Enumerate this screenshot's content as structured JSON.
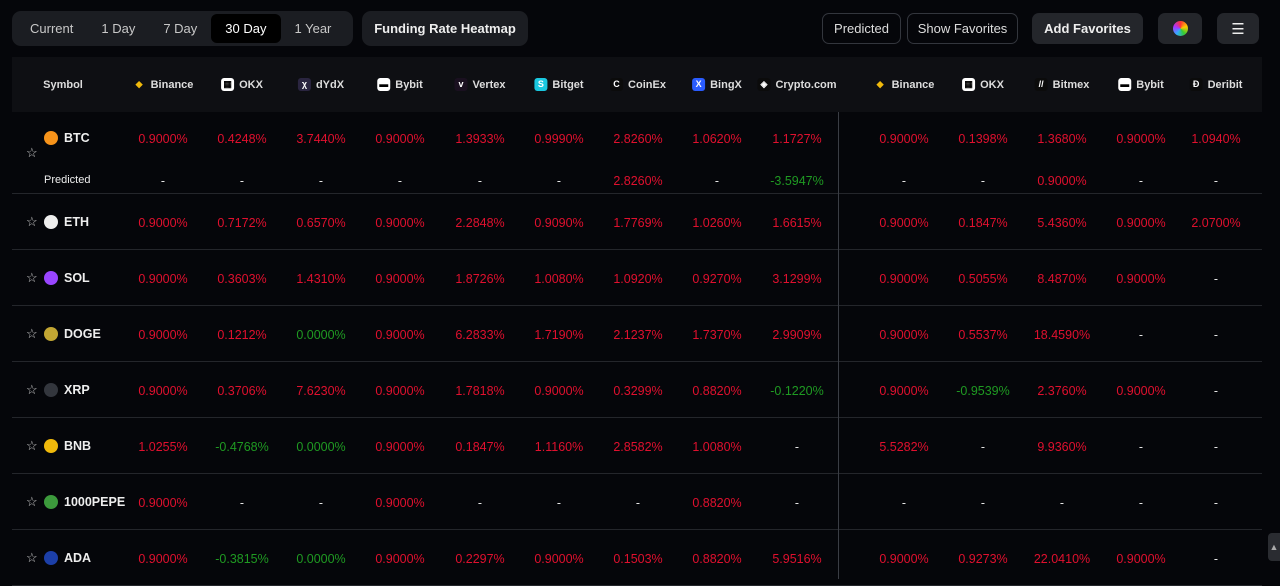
{
  "tabs": [
    "Current",
    "1 Day",
    "7 Day",
    "30 Day",
    "1 Year"
  ],
  "active_tab": "30 Day",
  "heatmap_label": "Funding Rate Heatmap",
  "buttons": {
    "predicted": "Predicted",
    "show_favorites": "Show Favorites",
    "add_favorites": "Add Favorites"
  },
  "colors": {
    "positive": "#e0102e",
    "negative": "#1f9a22"
  },
  "table": {
    "symbol_header": "Symbol",
    "predicted_label": "Predicted",
    "exchanges": [
      {
        "name": "Binance",
        "icon": "binance-icon",
        "color": "#f0b90b",
        "glyph": "◆"
      },
      {
        "name": "OKX",
        "icon": "okx-icon",
        "color": "#ffffff",
        "glyph": "▦"
      },
      {
        "name": "dYdX",
        "icon": "dydx-icon",
        "color": "#2a2540",
        "glyph": "χ"
      },
      {
        "name": "Bybit",
        "icon": "bybit-icon",
        "color": "#ffffff",
        "glyph": "▬"
      },
      {
        "name": "Vertex",
        "icon": "vertex-icon",
        "color": "#1a1020",
        "glyph": "v"
      },
      {
        "name": "Bitget",
        "icon": "bitget-icon",
        "color": "#1ac8e0",
        "glyph": "S"
      },
      {
        "name": "CoinEx",
        "icon": "coinex-icon",
        "color": "#0b0b0b",
        "glyph": "C"
      },
      {
        "name": "BingX",
        "icon": "bingx-icon",
        "color": "#2a5cff",
        "glyph": "X"
      },
      {
        "name": "Crypto.com",
        "icon": "cryptocom-icon",
        "color": "#0b0b0b",
        "glyph": "◈"
      },
      {
        "name": "Binance",
        "icon": "binance-icon",
        "color": "#f0b90b",
        "glyph": "◆"
      },
      {
        "name": "OKX",
        "icon": "okx-icon",
        "color": "#ffffff",
        "glyph": "▦"
      },
      {
        "name": "Bitmex",
        "icon": "bitmex-icon",
        "color": "#0b0b0b",
        "glyph": "//"
      },
      {
        "name": "Bybit",
        "icon": "bybit-icon",
        "color": "#ffffff",
        "glyph": "▬"
      },
      {
        "name": "Deribit",
        "icon": "deribit-icon",
        "color": "#0b0b0b",
        "glyph": "Ð"
      }
    ],
    "rows": [
      {
        "symbol": "BTC",
        "coin_color": "#f7931a",
        "values": [
          "0.9000%",
          "0.4248%",
          "3.7440%",
          "0.9000%",
          "1.3933%",
          "0.9990%",
          "2.8260%",
          "1.0620%",
          "1.1727%",
          "0.9000%",
          "0.1398%",
          "1.3680%",
          "0.9000%",
          "1.0940%"
        ],
        "predicted": [
          "-",
          "-",
          "-",
          "-",
          "-",
          "-",
          "2.8260%",
          "-",
          "-3.5947%",
          "-",
          "-",
          "0.9000%",
          "-",
          "-"
        ]
      },
      {
        "symbol": "ETH",
        "coin_color": "#eeeeee",
        "values": [
          "0.9000%",
          "0.7172%",
          "0.6570%",
          "0.9000%",
          "2.2848%",
          "0.9090%",
          "1.7769%",
          "1.0260%",
          "1.6615%",
          "0.9000%",
          "0.1847%",
          "5.4360%",
          "0.9000%",
          "2.0700%"
        ]
      },
      {
        "symbol": "SOL",
        "coin_color": "#9945ff",
        "values": [
          "0.9000%",
          "0.3603%",
          "1.4310%",
          "0.9000%",
          "1.8726%",
          "1.0080%",
          "1.0920%",
          "0.9270%",
          "3.1299%",
          "0.9000%",
          "0.5055%",
          "8.4870%",
          "0.9000%",
          "-"
        ]
      },
      {
        "symbol": "DOGE",
        "coin_color": "#c2a633",
        "values": [
          "0.9000%",
          "0.1212%",
          "0.0000%",
          "0.9000%",
          "6.2833%",
          "1.7190%",
          "2.1237%",
          "1.7370%",
          "2.9909%",
          "0.9000%",
          "0.5537%",
          "18.4590%",
          "-",
          "-"
        ]
      },
      {
        "symbol": "XRP",
        "coin_color": "#33363d",
        "values": [
          "0.9000%",
          "0.3706%",
          "7.6230%",
          "0.9000%",
          "1.7818%",
          "0.9000%",
          "0.3299%",
          "0.8820%",
          "-0.1220%",
          "0.9000%",
          "-0.9539%",
          "2.3760%",
          "0.9000%",
          "-"
        ]
      },
      {
        "symbol": "BNB",
        "coin_color": "#f0b90b",
        "values": [
          "1.0255%",
          "-0.4768%",
          "0.0000%",
          "0.9000%",
          "0.1847%",
          "1.1160%",
          "2.8582%",
          "1.0080%",
          "-",
          "5.5282%",
          "-",
          "9.9360%",
          "-",
          "-"
        ]
      },
      {
        "symbol": "1000PEPE",
        "coin_color": "#3c9a3c",
        "values": [
          "0.9000%",
          "-",
          "-",
          "0.9000%",
          "-",
          "-",
          "-",
          "0.8820%",
          "-",
          "-",
          "-",
          "-",
          "-",
          "-"
        ]
      },
      {
        "symbol": "ADA",
        "coin_color": "#1c3fa8",
        "values": [
          "0.9000%",
          "-0.3815%",
          "0.0000%",
          "0.9000%",
          "0.2297%",
          "0.9000%",
          "0.1503%",
          "0.8820%",
          "5.9516%",
          "0.9000%",
          "0.9273%",
          "22.0410%",
          "0.9000%",
          "-"
        ]
      }
    ]
  }
}
